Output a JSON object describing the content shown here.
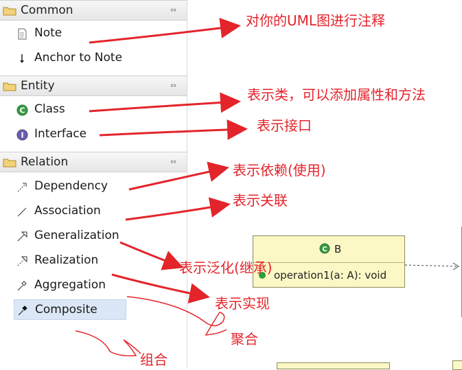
{
  "palette": {
    "drawers": [
      {
        "title": "Common",
        "items": [
          {
            "label": "Note",
            "icon": "note-icon"
          },
          {
            "label": "Anchor to Note",
            "icon": "anchor-arrow-icon"
          }
        ]
      },
      {
        "title": "Entity",
        "items": [
          {
            "label": "Class",
            "icon": "class-icon"
          },
          {
            "label": "Interface",
            "icon": "interface-icon"
          }
        ]
      },
      {
        "title": "Relation",
        "items": [
          {
            "label": "Dependency",
            "icon": "dependency-icon"
          },
          {
            "label": "Association",
            "icon": "association-icon"
          },
          {
            "label": "Generalization",
            "icon": "generalization-icon"
          },
          {
            "label": "Realization",
            "icon": "realization-icon"
          },
          {
            "label": "Aggregation",
            "icon": "aggregation-icon"
          },
          {
            "label": "Composite",
            "icon": "composite-icon",
            "selected": true
          }
        ]
      }
    ],
    "collapse_glyph": "⇔"
  },
  "canvas": {
    "class_b": {
      "name": "B",
      "operation": "operation1(a: A): void"
    }
  },
  "annotations": {
    "note": "对你的UML图进行注释",
    "class": "表示类，可以添加属性和方法",
    "interface": "表示接口",
    "dependency": "表示依赖(使用)",
    "association": "表示关联",
    "generalization": "表示泛化(继承)",
    "realization": "表示实现",
    "aggregation": "聚合",
    "composite": "组合"
  },
  "colors": {
    "annotation": "#e3242b",
    "selection": "#dbe7f6",
    "class_fill": "#fbf8c6"
  }
}
